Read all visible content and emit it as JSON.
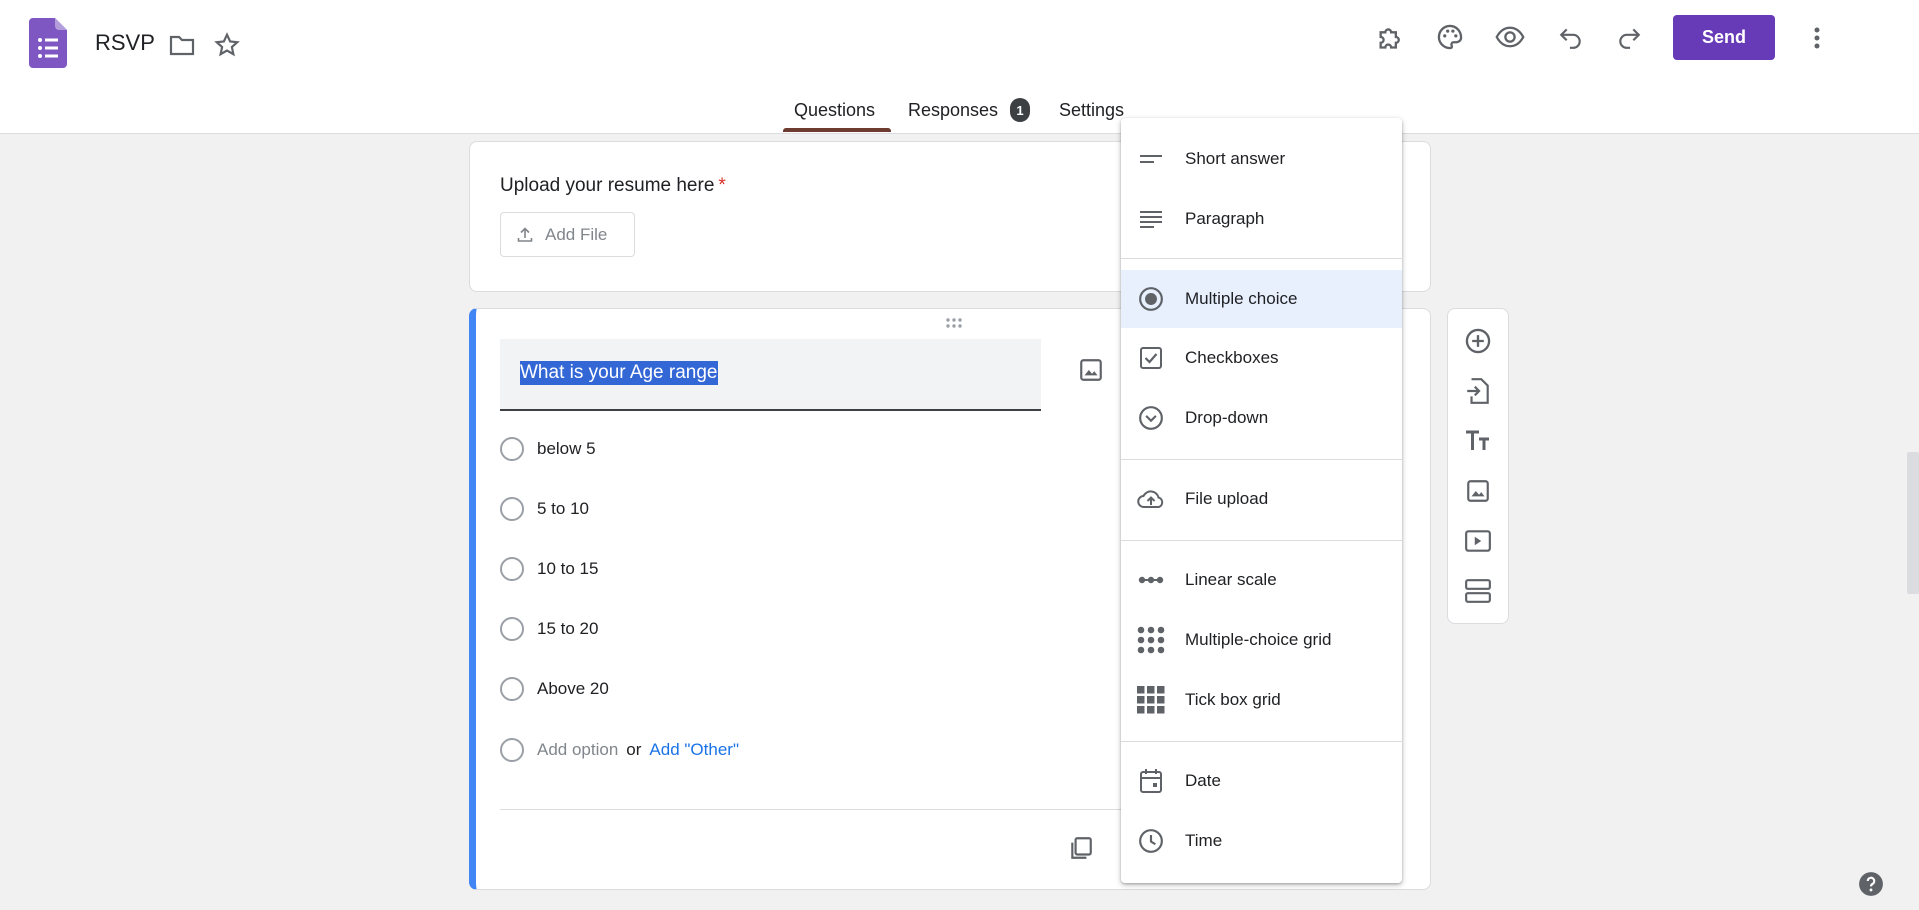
{
  "header": {
    "title": "RSVP",
    "send_label": "Send"
  },
  "tabs": [
    {
      "label": "Questions",
      "active": true
    },
    {
      "label": "Responses",
      "badge": "1"
    },
    {
      "label": "Settings"
    }
  ],
  "cards": {
    "upload": {
      "question": "Upload your resume here",
      "required_mark": "*",
      "add_file_label": "Add File"
    },
    "age": {
      "title": "What is your Age range",
      "options": [
        "below 5",
        "5 to 10",
        "10 to 15",
        "15 to 20",
        "Above 20"
      ],
      "add_option": "Add option",
      "or_text": "or",
      "add_other": "Add \"Other\""
    }
  },
  "type_menu": {
    "items": [
      {
        "label": "Short answer",
        "icon": "short-answer-icon"
      },
      {
        "label": "Paragraph",
        "icon": "paragraph-icon"
      },
      {
        "label": "Multiple choice",
        "icon": "radio-icon",
        "selected": true
      },
      {
        "label": "Checkboxes",
        "icon": "checkbox-icon"
      },
      {
        "label": "Drop-down",
        "icon": "dropdown-icon"
      },
      {
        "label": "File upload",
        "icon": "cloud-upload-icon"
      },
      {
        "label": "Linear scale",
        "icon": "linear-scale-icon"
      },
      {
        "label": "Multiple-choice grid",
        "icon": "dot-grid-icon"
      },
      {
        "label": "Tick box grid",
        "icon": "square-grid-icon"
      },
      {
        "label": "Date",
        "icon": "calendar-icon"
      },
      {
        "label": "Time",
        "icon": "clock-icon"
      }
    ]
  },
  "colors": {
    "brand": "#673ab7",
    "accent": "#4285f4",
    "selection": "#3367d6"
  }
}
